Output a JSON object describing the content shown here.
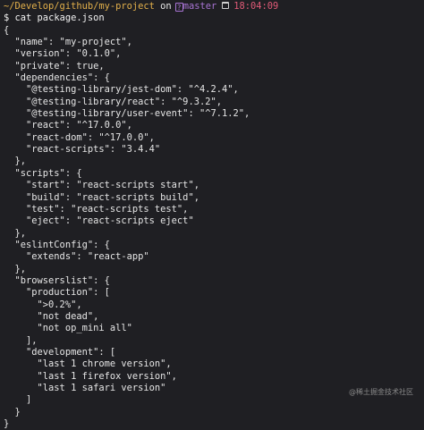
{
  "prompt": {
    "path": "~/Develop/github/my-project",
    "on": "on",
    "git_glyph": "?",
    "branch": "master",
    "time": "18:04:09",
    "symbol": "$",
    "command": "cat package.json"
  },
  "output_lines": [
    "{",
    "  \"name\": \"my-project\",",
    "  \"version\": \"0.1.0\",",
    "  \"private\": true,",
    "  \"dependencies\": {",
    "    \"@testing-library/jest-dom\": \"^4.2.4\",",
    "    \"@testing-library/react\": \"^9.3.2\",",
    "    \"@testing-library/user-event\": \"^7.1.2\",",
    "    \"react\": \"^17.0.0\",",
    "    \"react-dom\": \"^17.0.0\",",
    "    \"react-scripts\": \"3.4.4\"",
    "  },",
    "  \"scripts\": {",
    "    \"start\": \"react-scripts start\",",
    "    \"build\": \"react-scripts build\",",
    "    \"test\": \"react-scripts test\",",
    "    \"eject\": \"react-scripts eject\"",
    "  },",
    "  \"eslintConfig\": {",
    "    \"extends\": \"react-app\"",
    "  },",
    "  \"browserslist\": {",
    "    \"production\": [",
    "      \">0.2%\",",
    "      \"not dead\",",
    "      \"not op_mini all\"",
    "    ],",
    "    \"development\": [",
    "      \"last 1 chrome version\",",
    "      \"last 1 firefox version\",",
    "      \"last 1 safari version\"",
    "    ]",
    "  }",
    "}"
  ],
  "watermark": "@稀土掘金技术社区",
  "colors": {
    "background": "#1f1f23",
    "path": "#e3b04b",
    "branch": "#a874d4",
    "time": "#e05a77",
    "text": "#e6e6e6"
  }
}
